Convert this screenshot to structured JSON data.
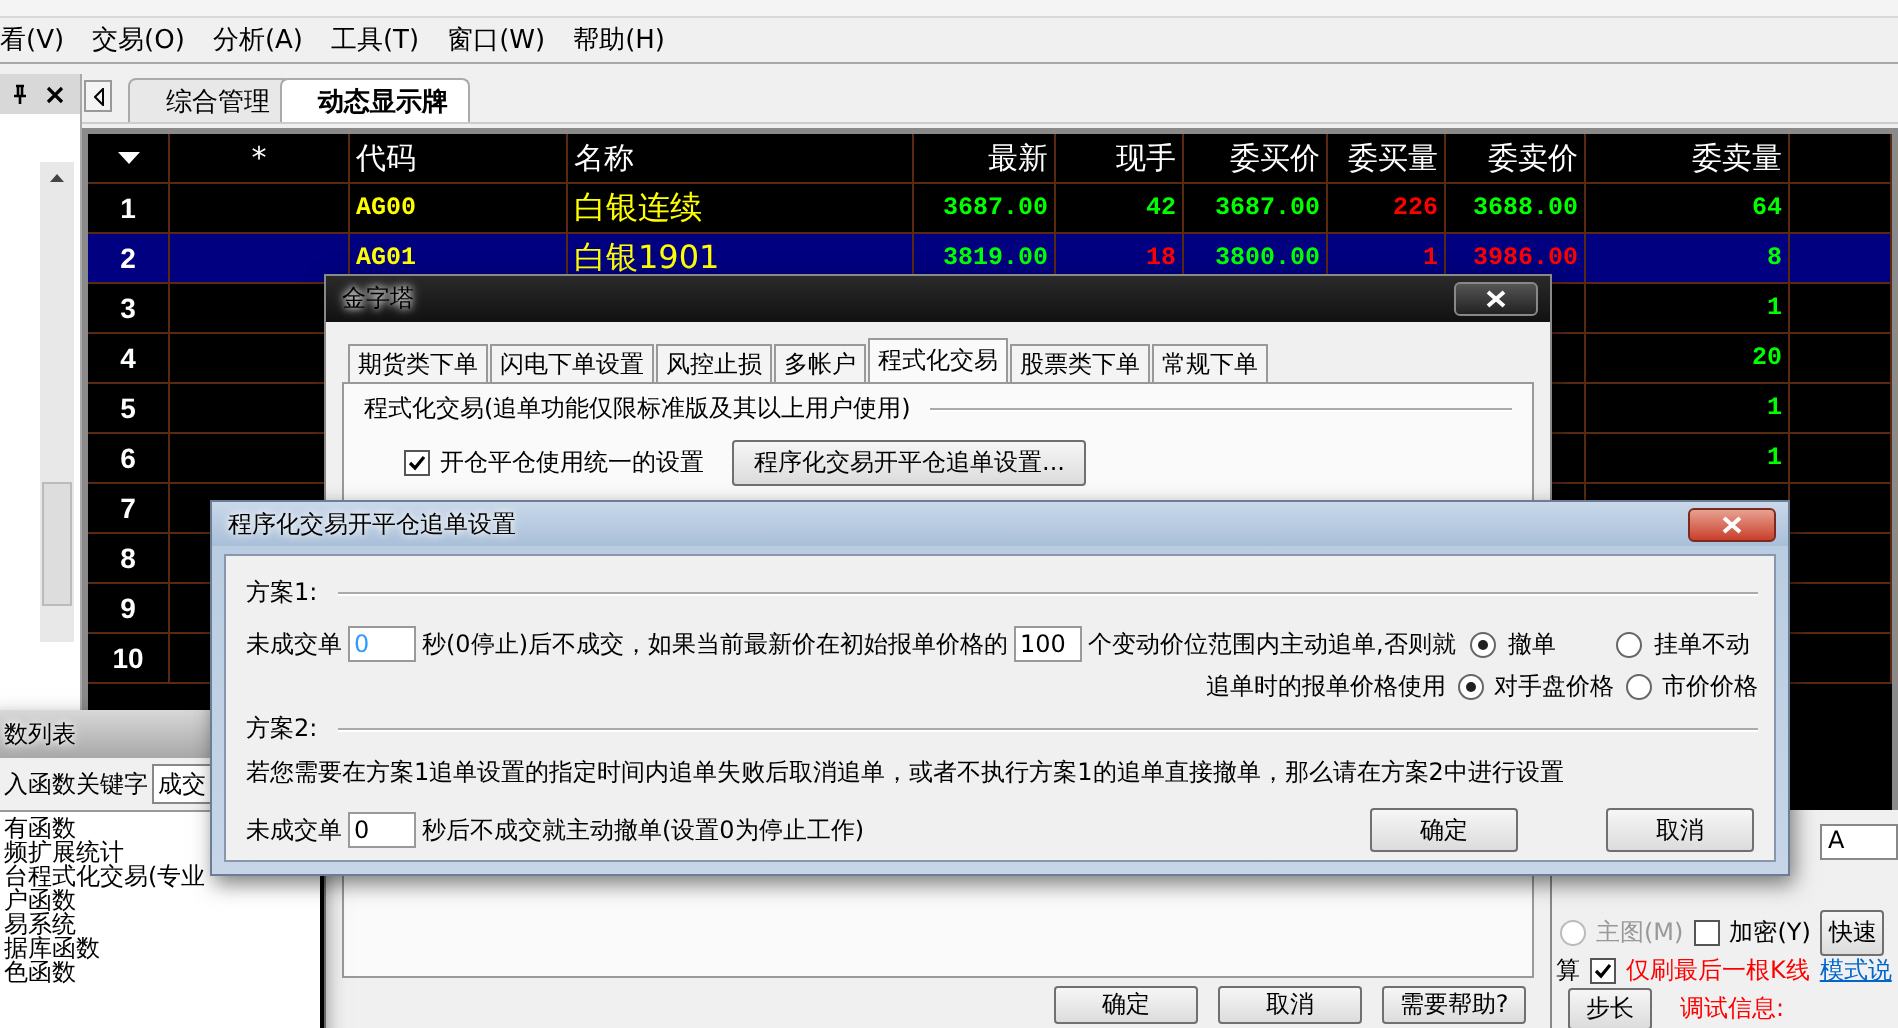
{
  "menu": [
    "看(V)",
    "交易(O)",
    "分析(A)",
    "工具(T)",
    "窗口(W)",
    "帮助(H)"
  ],
  "doc_tabs": [
    {
      "label": "综合管理",
      "selected": false
    },
    {
      "label": "动态显示牌",
      "selected": true
    }
  ],
  "quote_table": {
    "columns": [
      "*",
      "代码",
      "名称",
      "最新",
      "现手",
      "委买价",
      "委买量",
      "委卖价",
      "委卖量"
    ],
    "rows": [
      {
        "no": "1",
        "selected": false,
        "cells": [
          {
            "text": "AG00",
            "color": "#ffff00"
          },
          {
            "text": "白银连续",
            "color": "#ffff00"
          },
          {
            "text": "3687.00",
            "color": "#00ff00"
          },
          {
            "text": "42",
            "color": "#00ff00"
          },
          {
            "text": "3687.00",
            "color": "#00ff00"
          },
          {
            "text": "226",
            "color": "#ff0000"
          },
          {
            "text": "3688.00",
            "color": "#00ff00"
          },
          {
            "text": "64",
            "color": "#00ff00"
          }
        ]
      },
      {
        "no": "2",
        "selected": true,
        "cells": [
          {
            "text": "AG01",
            "color": "#ffff00"
          },
          {
            "text": "白银1901",
            "color": "#ffff00"
          },
          {
            "text": "3819.00",
            "color": "#00ff00"
          },
          {
            "text": "18",
            "color": "#ff0000"
          },
          {
            "text": "3800.00",
            "color": "#00ff00"
          },
          {
            "text": "1",
            "color": "#ff0000"
          },
          {
            "text": "3986.00",
            "color": "#ff0000"
          },
          {
            "text": "8",
            "color": "#00ff00"
          }
        ]
      },
      {
        "no": "3",
        "selected": false,
        "cells": [
          {
            "text": "1",
            "color": "#00ff00"
          }
        ]
      },
      {
        "no": "4",
        "selected": false,
        "cells": [
          {
            "text": "20",
            "color": "#00ff00"
          }
        ]
      },
      {
        "no": "5",
        "selected": false,
        "cells": [
          {
            "text": "1",
            "color": "#00ff00"
          }
        ]
      },
      {
        "no": "6",
        "selected": false,
        "cells": [
          {
            "text": "1",
            "color": "#00ff00"
          }
        ]
      },
      {
        "no": "7",
        "selected": false
      },
      {
        "no": "8",
        "selected": false
      },
      {
        "no": "9",
        "selected": false
      },
      {
        "no": "10",
        "selected": false
      }
    ]
  },
  "options_dialog": {
    "title": "金字塔",
    "tabs": [
      {
        "label": "期货类下单",
        "selected": false
      },
      {
        "label": "闪电下单设置",
        "selected": false
      },
      {
        "label": "风控止损",
        "selected": false
      },
      {
        "label": "多帐户",
        "selected": false
      },
      {
        "label": "程式化交易",
        "selected": true
      },
      {
        "label": "股票类下单",
        "selected": false
      },
      {
        "label": "常规下单",
        "selected": false
      }
    ],
    "group_title": "程式化交易(追单功能仅限标准版及其以上用户使用)",
    "unified_checkbox": {
      "label": "开仓平仓使用统一的设置",
      "checked": true
    },
    "settings_button": "程序化交易开平仓追单设置...",
    "buttons": [
      "确定",
      "取消",
      "需要帮助?"
    ]
  },
  "chase_dialog": {
    "title": "程序化交易开平仓追单设置",
    "plan1": {
      "label": "方案1:",
      "timeout_label": "未成交单",
      "timeout_value": "0",
      "mid_text": "秒(0停止)后不成交，如果当前最新价在初始报单价格的",
      "ticks_value": "100",
      "tail_text": "个变动价位范围内主动追单,否则就",
      "fallback_options": [
        {
          "label": "撤单",
          "selected": true
        },
        {
          "label": "挂单不动",
          "selected": false
        }
      ],
      "price_label": "追单时的报单价格使用",
      "price_options": [
        {
          "label": "对手盘价格",
          "selected": true
        },
        {
          "label": "市价价格",
          "selected": false
        }
      ]
    },
    "plan2": {
      "label": "方案2:",
      "description": "若您需要在方案1追单设置的指定时间内追单失败后取消追单，或者不执行方案1的追单直接撤单，那么请在方案2中进行设置",
      "timeout_label": "未成交单",
      "timeout_value": "0",
      "tail_text": "秒后不成交就主动撤单(设置0为停止工作)"
    },
    "buttons": [
      "确定",
      "取消"
    ]
  },
  "function_list": {
    "title": "数列表",
    "search_label": "入函数关键字",
    "search_value": "成交",
    "items": [
      "有函数",
      "频扩展统计",
      "台程式化交易(专业",
      "户函数",
      "易系统",
      "据库函数",
      "色函数"
    ]
  },
  "formula_panel": {
    "field_value": "A",
    "main_chart_radio": {
      "label": "主图(M)",
      "selected": false,
      "disabled": true
    },
    "encrypt_checkbox": {
      "label": "加密(Y)",
      "checked": false
    },
    "quick_button": "快速",
    "partial_label": "算",
    "last_bar_checkbox": {
      "label": "仅刷最后一根K线",
      "checked": true
    },
    "help_link": "模式说",
    "step_button": "步长",
    "debug_label": "调试信息:"
  }
}
